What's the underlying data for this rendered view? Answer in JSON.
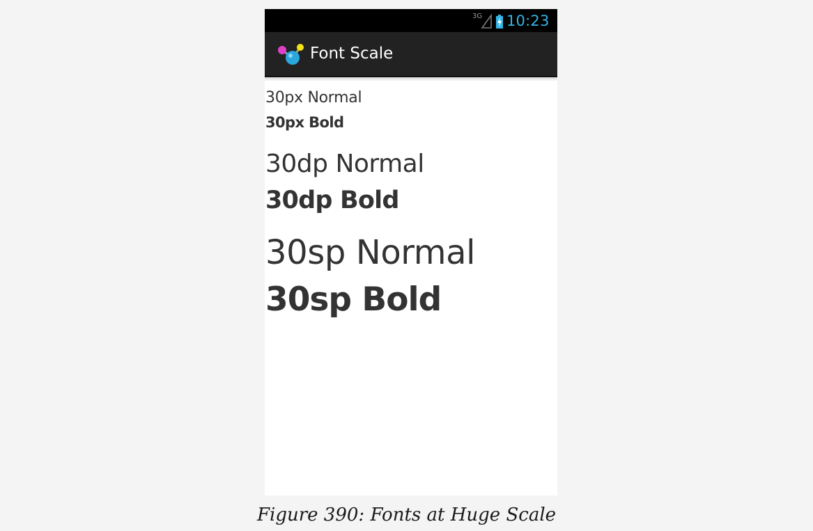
{
  "status_bar": {
    "network": "3G",
    "time": "10:23",
    "icons": [
      "signal-icon",
      "battery-icon"
    ],
    "time_color": "#33b5e5"
  },
  "action_bar": {
    "title": "Font Scale",
    "icon": "app-launcher-icon",
    "background": "#222222"
  },
  "content": {
    "lines": [
      "30px Normal",
      "30px Bold",
      "30dp Normal",
      "30dp Bold",
      "30sp Normal",
      "30sp Bold"
    ],
    "text_color": "#333333"
  },
  "caption": "Figure 390: Fonts at Huge Scale"
}
